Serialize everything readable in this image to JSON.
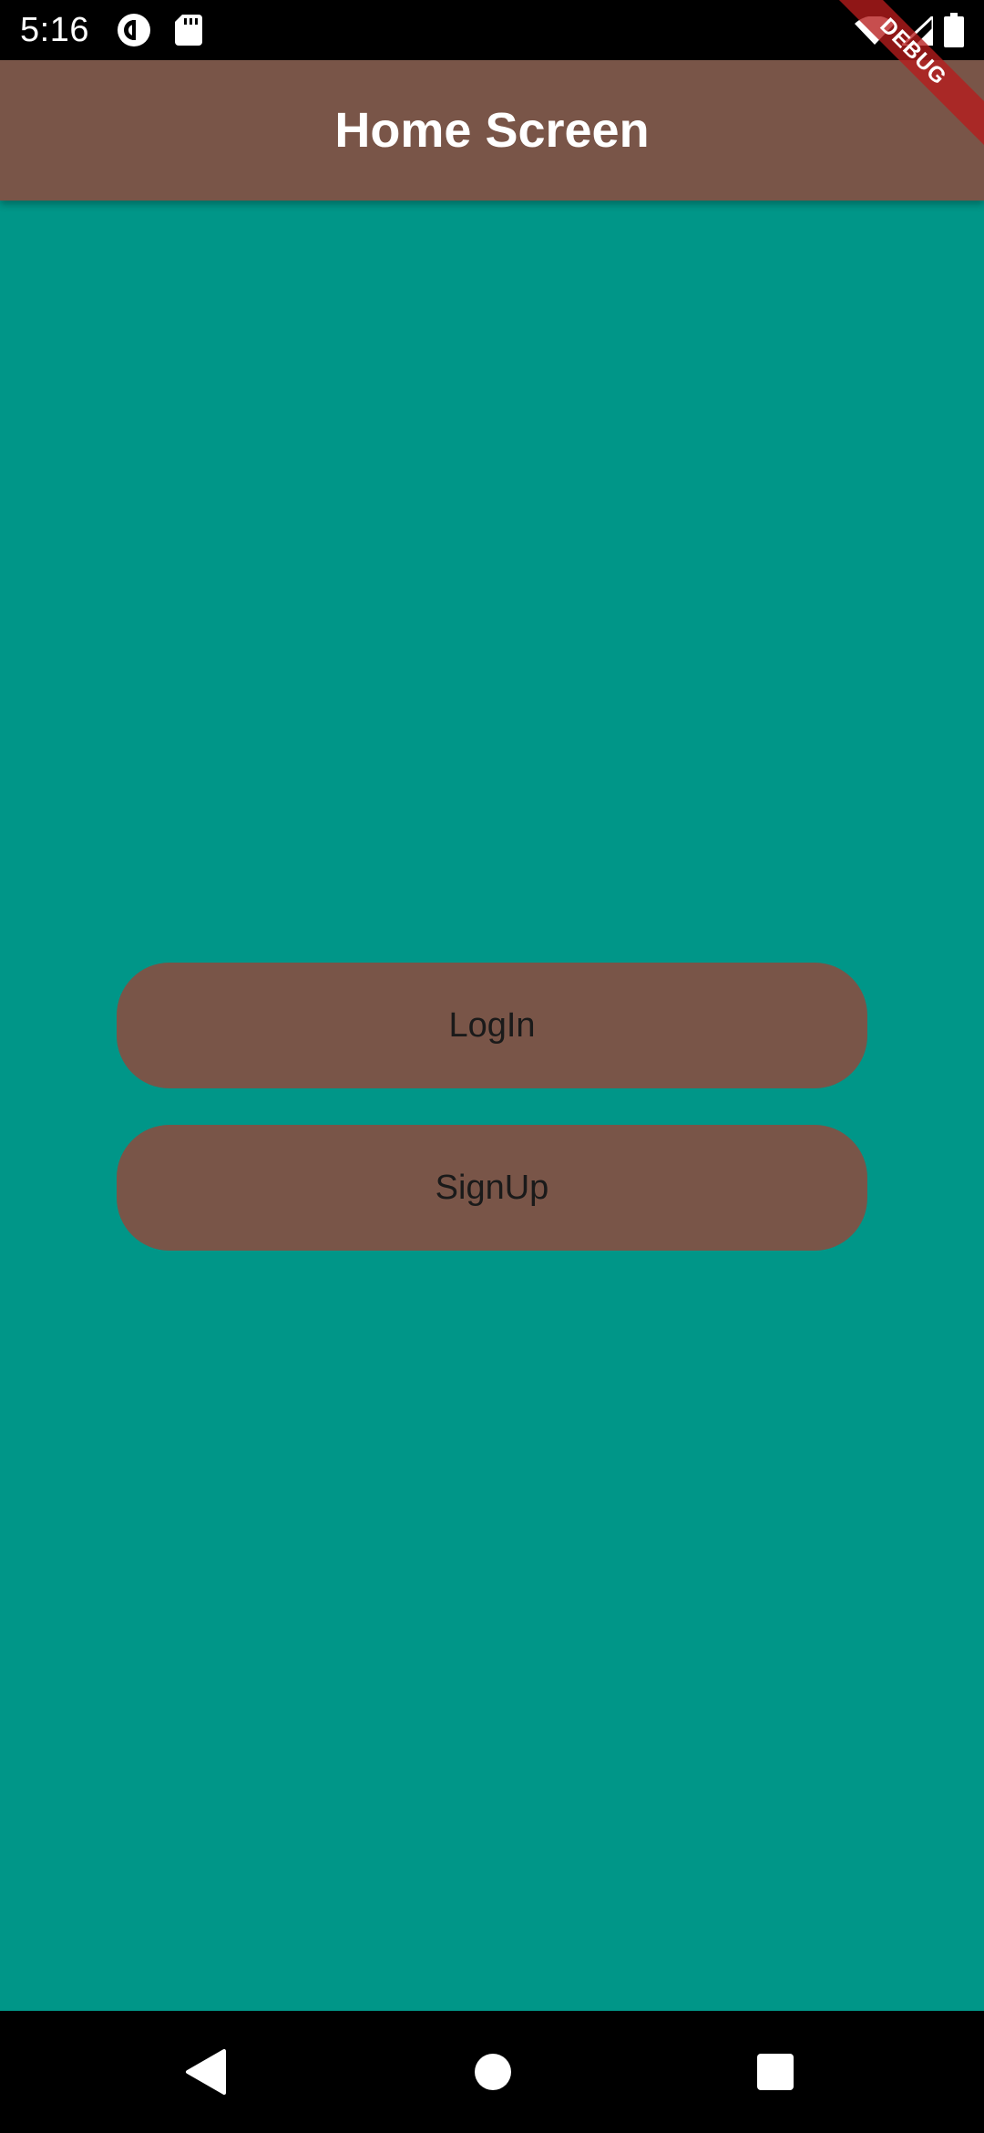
{
  "status_bar": {
    "time": "5:16",
    "icons": [
      "pocket-casts-icon",
      "sd-card-icon",
      "wifi-icon",
      "signal-icon",
      "battery-icon"
    ]
  },
  "app_bar": {
    "title": "Home Screen",
    "color": "#795548"
  },
  "debug_banner": {
    "label": "DEBUG"
  },
  "buttons": {
    "login_label": "LogIn",
    "signup_label": "SignUp",
    "color": "#795548"
  },
  "background_color": "#009688",
  "nav_bar": {
    "icons": [
      "back-icon",
      "home-icon",
      "recents-icon"
    ]
  }
}
